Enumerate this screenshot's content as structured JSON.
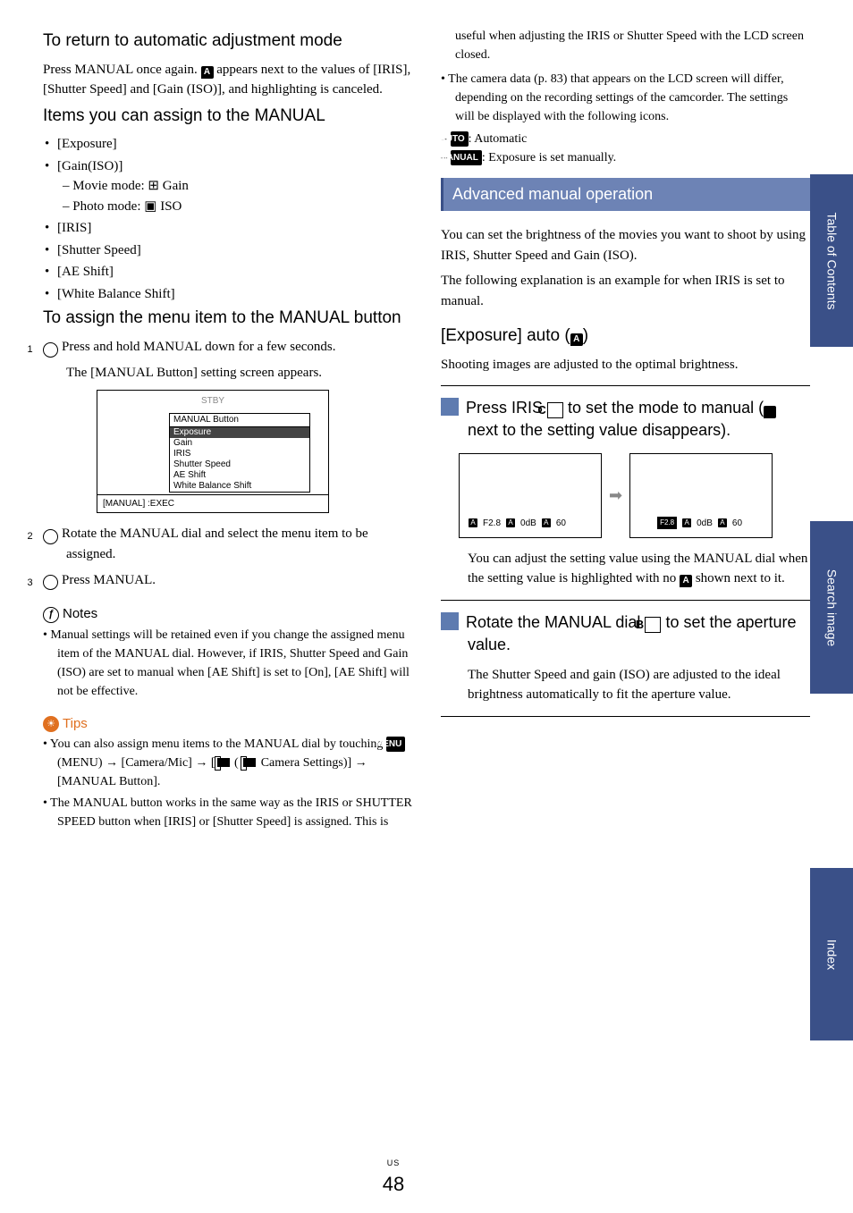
{
  "col1": {
    "h_return": "To return to automatic adjustment mode",
    "p_return_a": "Press MANUAL once again. ",
    "p_return_b": " appears next to the values of [IRIS], [Shutter Speed] and [Gain (ISO)], and highlighting is canceled.",
    "h_items": "Items you can assign to the MANUAL",
    "items": {
      "exposure": "[Exposure]",
      "gain": "[Gain(ISO)]",
      "gain_movie": "Movie mode: ",
      "gain_movie_lbl": " Gain",
      "gain_photo": "Photo mode: ",
      "gain_photo_lbl": " ISO",
      "iris": "[IRIS]",
      "shutter": "[Shutter Speed]",
      "ae": "[AE Shift]",
      "wb": "[White Balance Shift]"
    },
    "h_assign": "To assign the menu item to the MANUAL button",
    "s1": "Press and hold MANUAL down for a few seconds.",
    "s1b": "The [MANUAL Button] setting screen appears.",
    "shot": {
      "stby": "STBY",
      "title": "MANUAL Button",
      "sel": "Exposure",
      "o1": "Gain",
      "o2": "IRIS",
      "o3": "Shutter Speed",
      "o4": "AE Shift",
      "o5": "White Balance Shift",
      "foot": "[MANUAL] :EXEC"
    },
    "s2": "Rotate the MANUAL dial and select the menu item to be assigned.",
    "s3": "Press MANUAL.",
    "notes_hd": "Notes",
    "note1": "Manual settings will be retained even if you change the assigned menu item of the MANUAL dial. However, if IRIS, Shutter Speed and Gain (ISO) are set to manual when [AE Shift] is set to [On], [AE Shift] will not be effective.",
    "tips_hd": "Tips",
    "tip1a": "You can also assign menu items to the MANUAL dial by touching ",
    "tip1_menu": "MENU",
    "tip1b": " (MENU) → [Camera/Mic] → [",
    "tip1c": " ( ",
    "tip1d": " Camera Settings)] → [MANUAL Button].",
    "tip2": "The MANUAL button works in the same way as the IRIS or SHUTTER SPEED button when [IRIS] or [Shutter Speed] is assigned. This is"
  },
  "col2": {
    "cont1": "useful when adjusting the IRIS or Shutter Speed with the LCD screen closed.",
    "cont2": "The camera data (p. 83) that appears on the LCD screen will differ, depending on the recording settings of the camcorder. The settings will be displayed with the following icons.",
    "ic_auto": "AUTO",
    "ic_auto_t": ": Automatic",
    "ic_man": "MANUAL",
    "ic_man_t": ": Exposure is set manually.",
    "sec": "Advanced manual operation",
    "intro1": "You can set the brightness of the movies you want to shoot by using IRIS, Shutter Speed and Gain (ISO).",
    "intro2": "The following explanation is an example for when IRIS is set to manual.",
    "h_auto": "[Exposure] auto (",
    "h_auto_end": ")",
    "auto_p": "Shooting images are adjusted to the optimal brightness.",
    "step1a": "Press IRIS ",
    "step1b": " to set the mode to manual (",
    "step1c": " next to the setting value disappears).",
    "diag": {
      "f28": "F2.8",
      "odb": "0dB",
      "sixty": "60"
    },
    "after1a": "You can adjust the setting value using the MANUAL dial when the setting value is highlighted with no ",
    "after1b": " shown next to it.",
    "step2a": "Rotate the MANUAL dial ",
    "step2b": " to set the aperture value.",
    "after2": "The Shutter Speed and gain (ISO) are adjusted to the ideal brightness automatically to fit the aperture value."
  },
  "tabs": {
    "toc": "Table of Contents",
    "search": "Search image",
    "index": "Index"
  },
  "page": {
    "us": "US",
    "num": "48"
  }
}
